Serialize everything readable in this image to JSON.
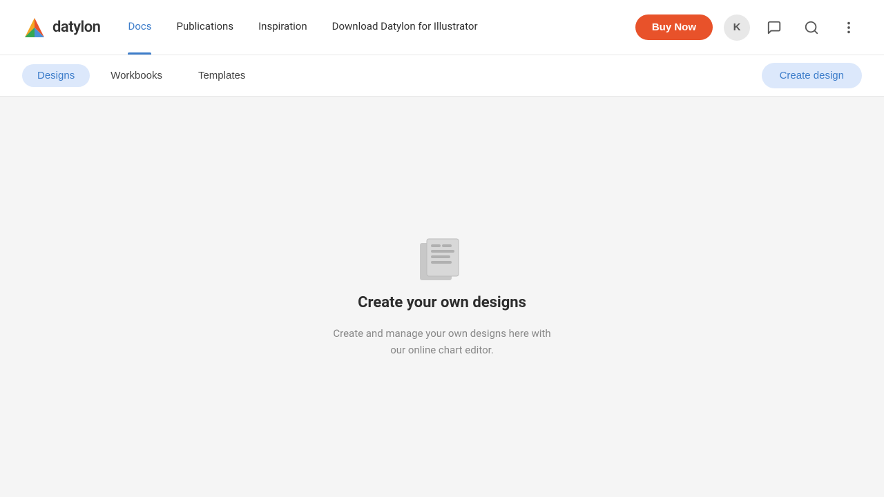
{
  "navbar": {
    "logo_text": "datylon",
    "links": [
      {
        "label": "Docs",
        "active": true
      },
      {
        "label": "Publications",
        "active": false
      },
      {
        "label": "Inspiration",
        "active": false
      },
      {
        "label": "Download Datylon for Illustrator",
        "active": false
      }
    ],
    "buy_now_label": "Buy Now",
    "avatar_label": "K",
    "colors": {
      "active_link": "#3d7dca",
      "buy_now_bg": "#e8522a"
    }
  },
  "tabs": {
    "items": [
      {
        "label": "Designs",
        "active": true
      },
      {
        "label": "Workbooks",
        "active": false
      },
      {
        "label": "Templates",
        "active": false
      }
    ],
    "create_label": "Create design"
  },
  "empty_state": {
    "title": "Create your own designs",
    "description": "Create and manage your own designs here with our online chart editor."
  }
}
